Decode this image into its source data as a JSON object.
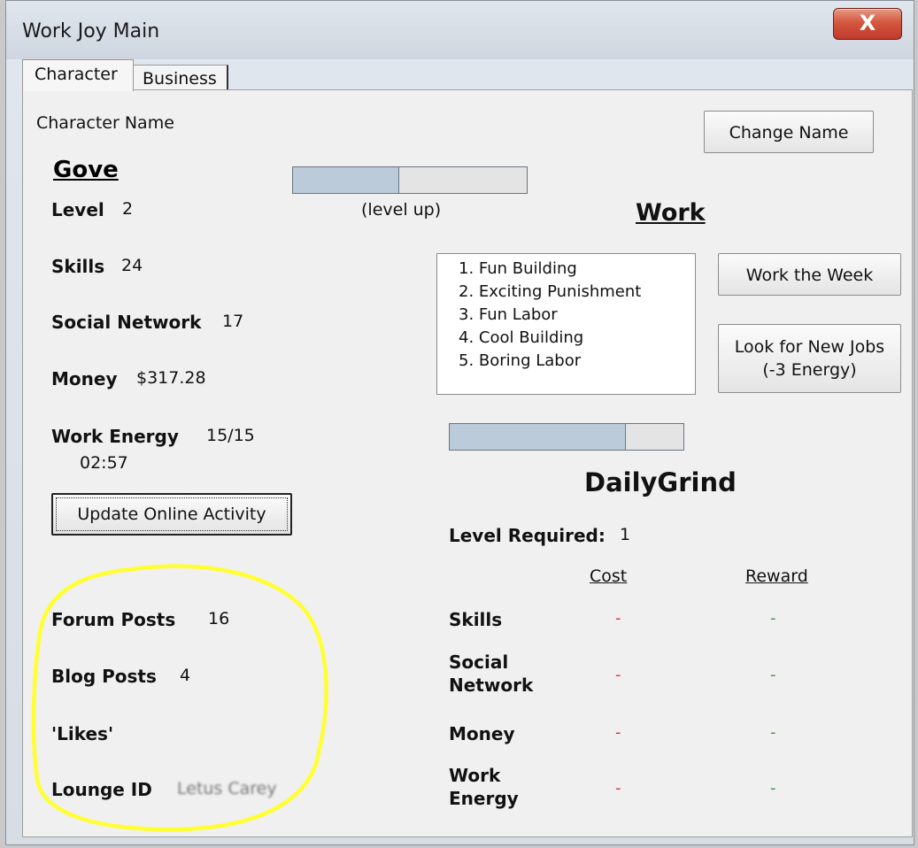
{
  "window": {
    "title": "Work Joy Main",
    "close_glyph": "X"
  },
  "tabs": [
    {
      "label": "Character",
      "active": true
    },
    {
      "label": "Business",
      "active": false
    }
  ],
  "character": {
    "name_label": "Character Name",
    "name": "Gove",
    "change_name_button": "Change Name",
    "level_label": "Level",
    "level": "2",
    "level_up_caption": "(level up)",
    "level_progress": 0.45,
    "skills_label": "Skills",
    "skills": "24",
    "social_label": "Social Network",
    "social": "17",
    "money_label": "Money",
    "money": "$317.28",
    "energy_label": "Work Energy",
    "energy": "15/15",
    "energy_timer": "02:57",
    "update_button": "Update Online Activity",
    "forum_label": "Forum Posts",
    "forum": "16",
    "blog_label": "Blog Posts",
    "blog": "4",
    "likes_label": "'Likes'",
    "likes": "",
    "lounge_label": "Lounge ID",
    "lounge": "Letus Carey"
  },
  "work": {
    "heading": "Work",
    "jobs": [
      "1. Fun Building",
      "2. Exciting Punishment",
      "3. Fun Labor",
      "4. Cool Building",
      "5. Boring Labor"
    ],
    "work_week_button": "Work the Week",
    "look_jobs_line1": "Look for New Jobs",
    "look_jobs_line2": "(-3 Energy)",
    "job_progress": 0.75,
    "job_title": "DailyGrind",
    "level_required_label": "Level Required:",
    "level_required": "1",
    "cost_header": "Cost",
    "reward_header": "Reward",
    "rows": [
      {
        "label1": "Skills",
        "label2": "",
        "cost": "-",
        "reward": "-"
      },
      {
        "label1": "Social",
        "label2": "Network",
        "cost": "-",
        "reward": "-"
      },
      {
        "label1": "Money",
        "label2": "",
        "cost": "-",
        "reward": "-"
      },
      {
        "label1": "Work",
        "label2": "Energy",
        "cost": "-",
        "reward": "-"
      }
    ]
  },
  "colors": {
    "highlight_circle": "#ffff33",
    "cost_color": "#d23a2a",
    "reward_color": "#3a9a3a",
    "bar_fill": "#bccbda"
  }
}
